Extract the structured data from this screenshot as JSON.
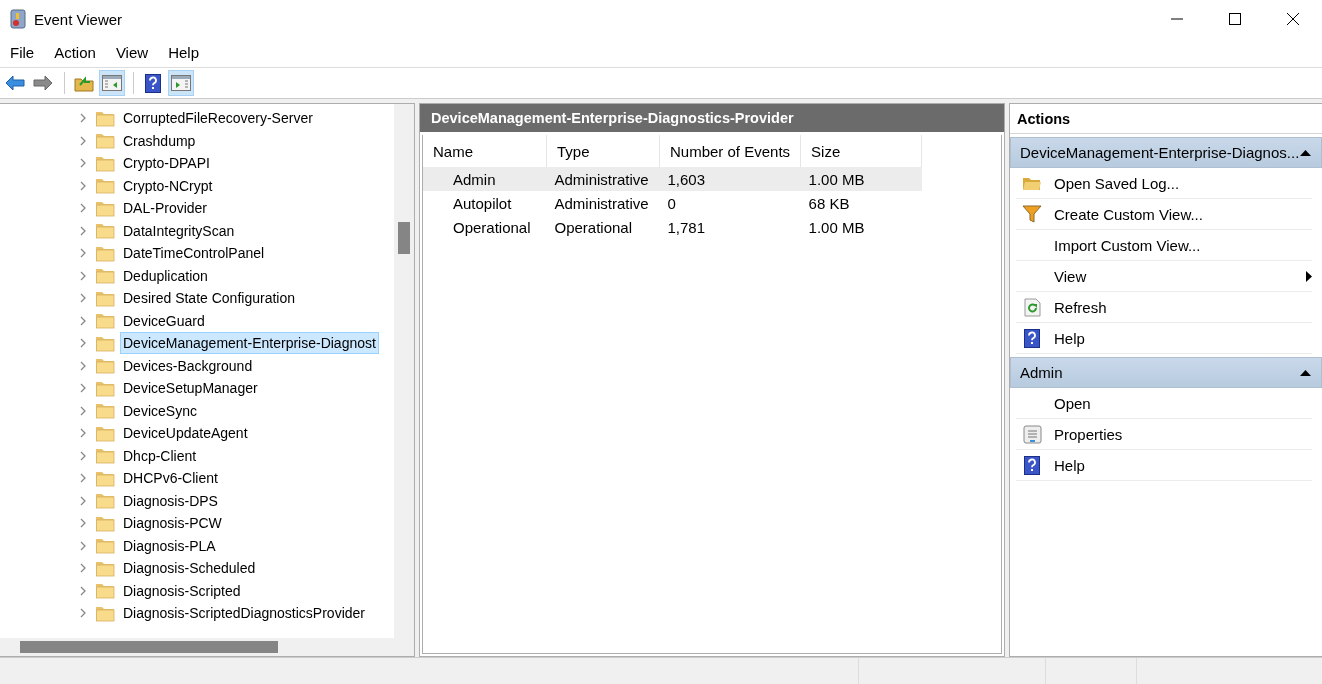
{
  "window": {
    "title": "Event Viewer"
  },
  "menu": [
    "File",
    "Action",
    "View",
    "Help"
  ],
  "toolbar": [
    {
      "kind": "back",
      "on": false
    },
    {
      "kind": "forward",
      "on": false
    },
    {
      "kind": "separator"
    },
    {
      "kind": "folder-up",
      "on": false
    },
    {
      "kind": "console-tree",
      "on": true
    },
    {
      "kind": "separator"
    },
    {
      "kind": "help",
      "on": false
    },
    {
      "kind": "action-pane",
      "on": true
    }
  ],
  "tree": {
    "items": [
      {
        "label": "CorruptedFileRecovery-Server",
        "expanded": false,
        "selected": false
      },
      {
        "label": "Crashdump",
        "expanded": false,
        "selected": false
      },
      {
        "label": "Crypto-DPAPI",
        "expanded": false,
        "selected": false
      },
      {
        "label": "Crypto-NCrypt",
        "expanded": false,
        "selected": false
      },
      {
        "label": "DAL-Provider",
        "expanded": false,
        "selected": false
      },
      {
        "label": "DataIntegrityScan",
        "expanded": false,
        "selected": false
      },
      {
        "label": "DateTimeControlPanel",
        "expanded": false,
        "selected": false
      },
      {
        "label": "Deduplication",
        "expanded": false,
        "selected": false
      },
      {
        "label": "Desired State Configuration",
        "expanded": false,
        "selected": false
      },
      {
        "label": "DeviceGuard",
        "expanded": false,
        "selected": false
      },
      {
        "label": "DeviceManagement-Enterprise-Diagnost",
        "expanded": false,
        "selected": true
      },
      {
        "label": "Devices-Background",
        "expanded": false,
        "selected": false
      },
      {
        "label": "DeviceSetupManager",
        "expanded": false,
        "selected": false
      },
      {
        "label": "DeviceSync",
        "expanded": false,
        "selected": false
      },
      {
        "label": "DeviceUpdateAgent",
        "expanded": false,
        "selected": false
      },
      {
        "label": "Dhcp-Client",
        "expanded": false,
        "selected": false
      },
      {
        "label": "DHCPv6-Client",
        "expanded": false,
        "selected": false
      },
      {
        "label": "Diagnosis-DPS",
        "expanded": false,
        "selected": false
      },
      {
        "label": "Diagnosis-PCW",
        "expanded": false,
        "selected": false
      },
      {
        "label": "Diagnosis-PLA",
        "expanded": false,
        "selected": false
      },
      {
        "label": "Diagnosis-Scheduled",
        "expanded": false,
        "selected": false
      },
      {
        "label": "Diagnosis-Scripted",
        "expanded": false,
        "selected": false
      },
      {
        "label": "Diagnosis-ScriptedDiagnosticsProvider",
        "expanded": false,
        "selected": false
      }
    ]
  },
  "list": {
    "title": "DeviceManagement-Enterprise-Diagnostics-Provider",
    "columns": [
      "Name",
      "Type",
      "Number of Events",
      "Size"
    ],
    "rows": [
      {
        "cells": [
          "Admin",
          "Administrative",
          "1,603",
          "1.00 MB"
        ],
        "selected": true
      },
      {
        "cells": [
          "Autopilot",
          "Administrative",
          "0",
          "68 KB"
        ],
        "selected": false
      },
      {
        "cells": [
          "Operational",
          "Operational",
          "1,781",
          "1.00 MB"
        ],
        "selected": false
      }
    ]
  },
  "actions": {
    "title": "Actions",
    "sections": [
      {
        "title": "DeviceManagement-Enterprise-Diagnos...",
        "expanded": true,
        "items": [
          {
            "label": "Open Saved Log...",
            "kind": "folder"
          },
          {
            "label": "Create Custom View...",
            "kind": "filter"
          },
          {
            "label": "Import Custom View...",
            "kind": "plain"
          },
          {
            "label": "View",
            "kind": "submenu"
          },
          {
            "label": "Refresh",
            "kind": "refresh"
          },
          {
            "label": "Help",
            "kind": "help"
          }
        ]
      },
      {
        "title": "Admin",
        "expanded": true,
        "items": [
          {
            "label": "Open",
            "kind": "plain"
          },
          {
            "label": "Properties",
            "kind": "properties"
          },
          {
            "label": "Help",
            "kind": "help"
          }
        ]
      }
    ]
  }
}
